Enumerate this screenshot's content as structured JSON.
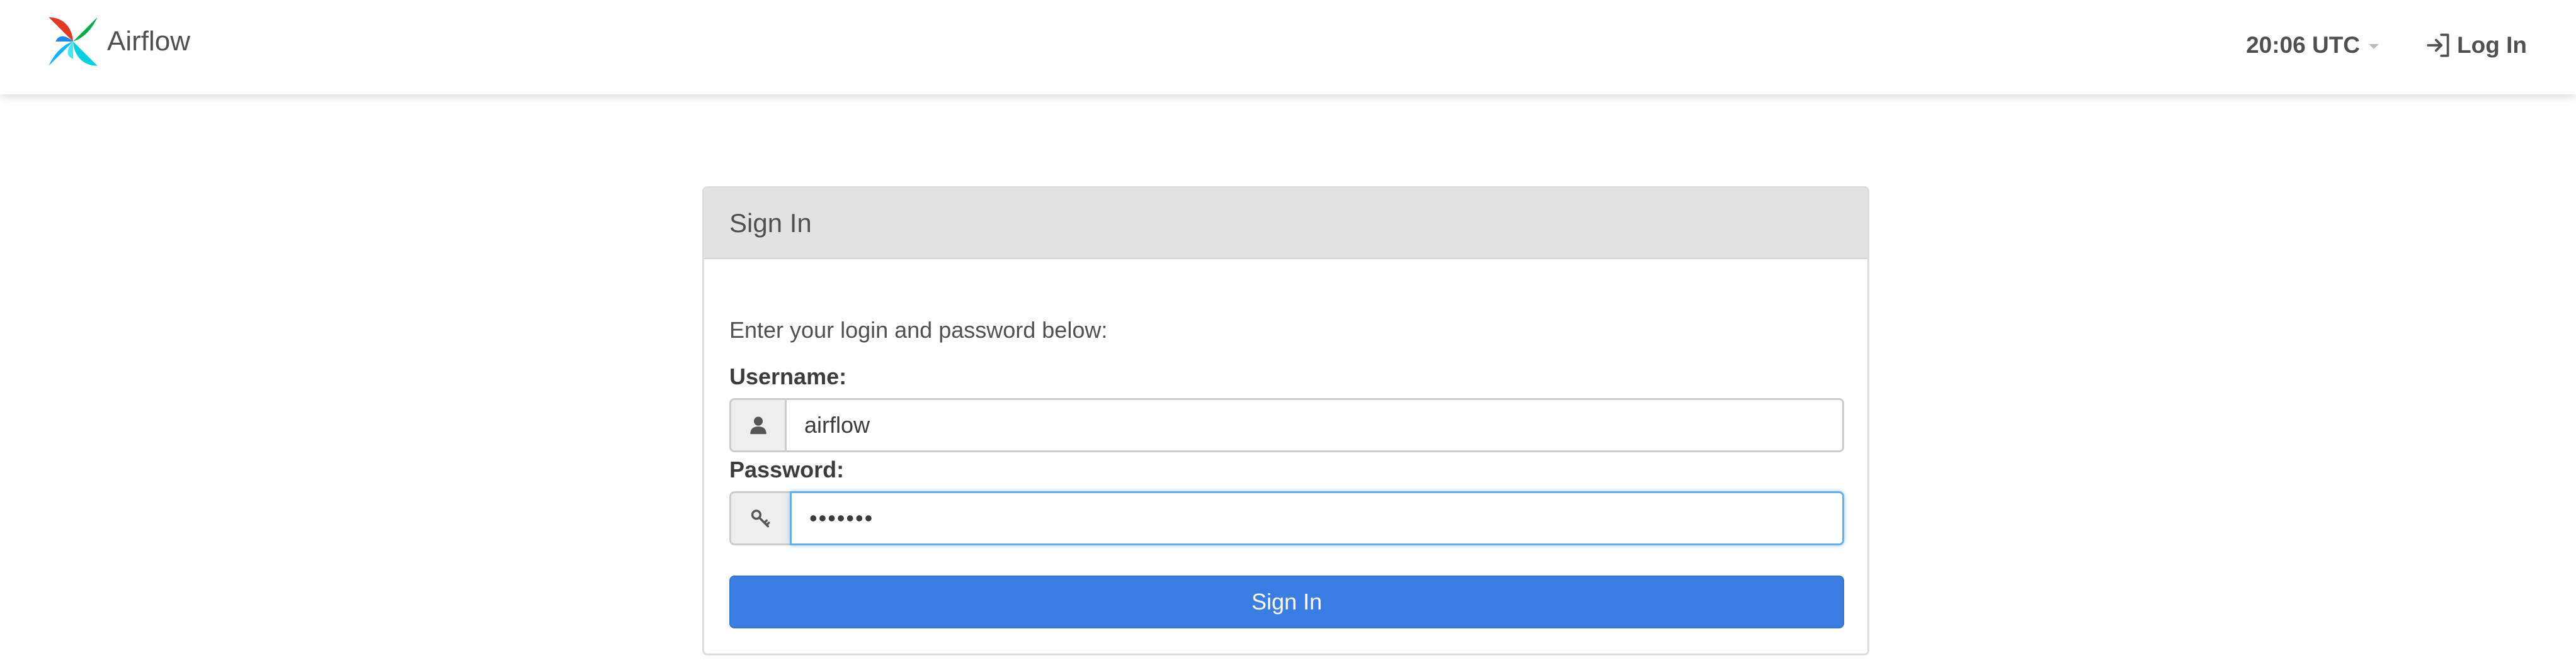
{
  "navbar": {
    "brand_name": "Airflow",
    "clock": "20:06 UTC",
    "login_label": "Log In"
  },
  "signin_panel": {
    "heading": "Sign In",
    "intro": "Enter your login and password below:",
    "username": {
      "label": "Username:",
      "value": "airflow",
      "icon": "user-icon"
    },
    "password": {
      "label": "Password:",
      "value": "•••••••",
      "icon": "key-icon"
    },
    "submit_label": "Sign In"
  },
  "colors": {
    "primary_button": "#3a7ee4",
    "panel_heading_bg": "#e2e2e2",
    "focus_border": "#66afe9",
    "text": "#51504f"
  }
}
